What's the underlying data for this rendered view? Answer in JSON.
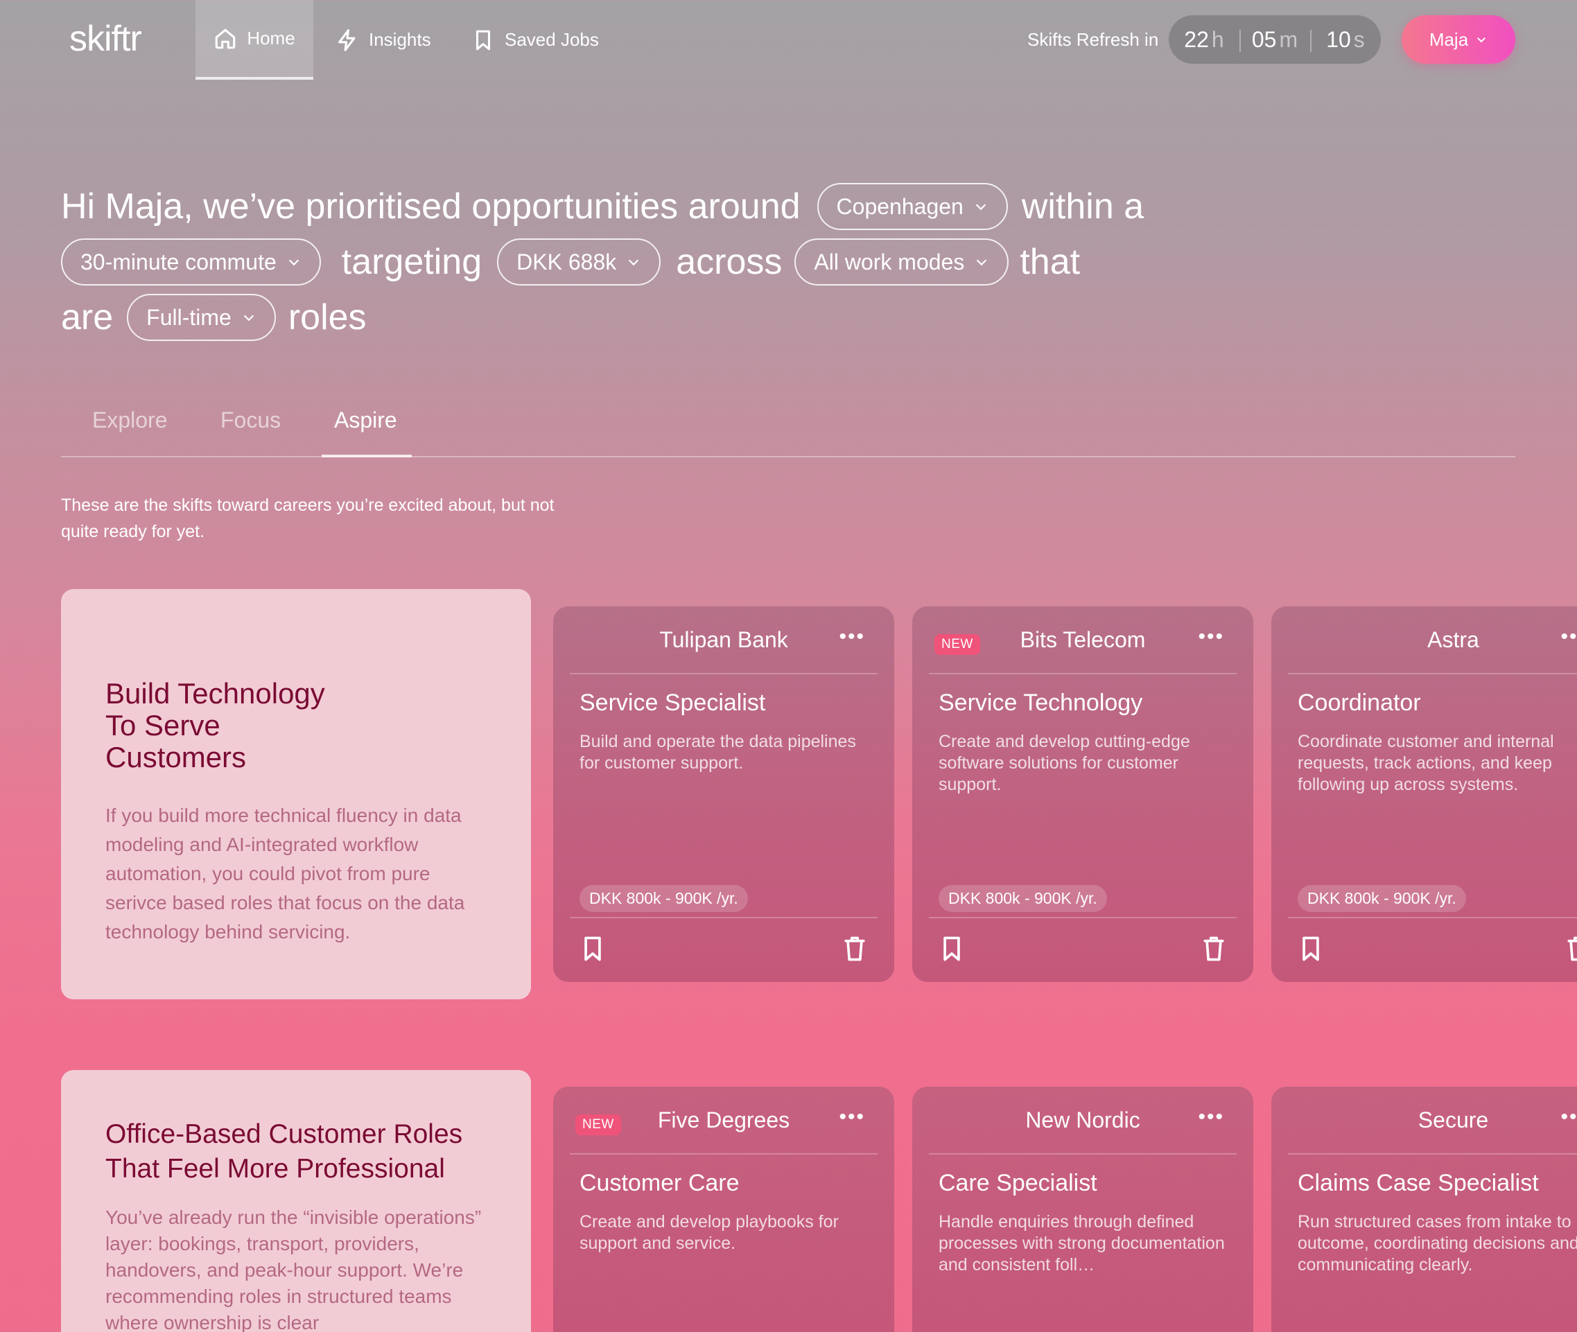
{
  "nav": {
    "logo": "skiftr",
    "items": [
      {
        "label": "Home",
        "icon": "home-icon"
      },
      {
        "label": "Insights",
        "icon": "lightning-icon"
      },
      {
        "label": "Saved Jobs",
        "icon": "bookmark-icon"
      }
    ],
    "refresh_label": "Skifts Refresh in",
    "timer": {
      "hours": "22",
      "hours_unit": "h",
      "minutes": "05",
      "minutes_unit": "m",
      "seconds": "10",
      "seconds_unit": "s"
    },
    "user": "Maja"
  },
  "hero": {
    "part1": "Hi Maja, we’ve prioritised opportunities around",
    "location": "Copenhagen",
    "part2": "within a",
    "commute": "30-minute commute",
    "part3": "targeting",
    "salary": "DKK 688k",
    "part4": "across",
    "work_mode": "All work modes",
    "part5": "that",
    "part6": "are",
    "employment": "Full-time",
    "part7": "roles"
  },
  "tabs": [
    {
      "label": "Explore",
      "active": false
    },
    {
      "label": "Focus",
      "active": false
    },
    {
      "label": "Aspire",
      "active": true
    }
  ],
  "tab_description": "These are the skifts toward careers you’re excited about, but not quite ready for yet.",
  "sections": [
    {
      "title": "Build Technology To Serve Customers",
      "title_lines": [
        "Build Technology",
        "To Serve",
        "Customers"
      ],
      "description": "If you build more technical fluency in data modeling and AI-integrated workflow automation, you could pivot from pure serivce based roles that focus on the data technology behind servicing.",
      "jobs": [
        {
          "company": "Tulipan Bank",
          "new": false,
          "title": "Service Specialist",
          "description": "Build and operate the data pipelines for customer support.",
          "salary": "DKK 800k - 900K /yr."
        },
        {
          "company": "Bits Telecom",
          "new": true,
          "title": "Service Technology",
          "description": "Create and develop cutting-edge software solutions for customer support.",
          "salary": "DKK 800k - 900K /yr."
        },
        {
          "company": "Astra",
          "new": false,
          "title": "Coordinator",
          "description": "Coordinate customer and internal requests, track actions, and keep following up across systems.",
          "salary": "DKK 800k - 900K /yr."
        }
      ]
    },
    {
      "title": "Office-Based Customer Roles That Feel More Professional",
      "title_lines": [
        "Office-Based Customer Roles",
        "That Feel More Professional"
      ],
      "description": "You’ve already run the “invisible operations” layer: bookings, transport, providers, handovers, and peak-hour support. We’re recommending roles in structured teams where ownership is clear",
      "jobs": [
        {
          "company": "Five Degrees",
          "new": true,
          "title": "Customer Care",
          "description": "Create and develop playbooks for support and service."
        },
        {
          "company": "New Nordic",
          "new": false,
          "title": "Care Specialist",
          "description": "Handle enquiries through defined processes with strong documentation and consistent foll…"
        },
        {
          "company": "Secure",
          "new": false,
          "title": "Claims Case Specialist",
          "description": "Run structured cases from intake to outcome, coordinating decisions and communicating clearly."
        }
      ]
    }
  ],
  "badge_new": "NEW",
  "more_glyph": "•••"
}
